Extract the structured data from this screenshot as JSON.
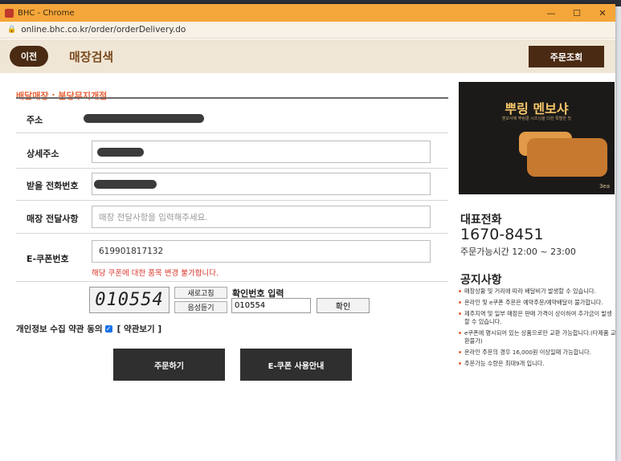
{
  "browser": {
    "title": "BHC - Chrome",
    "url": "online.bhc.co.kr/order/orderDelivery.do",
    "window_controls": [
      "minimize",
      "maximize",
      "close"
    ]
  },
  "header": {
    "back_label": "이전",
    "title": "매장검색",
    "order_lookup_label": "주문조회"
  },
  "form": {
    "store_label": "배달매장 : 분당무지개점",
    "address_label": "주소",
    "detail_address_label": "상세주소",
    "phone_label": "받을 전화번호",
    "message_label": "매장 전달사항",
    "message_placeholder": "매장 전달사항을 입력해주세요.",
    "coupon_label": "E-쿠폰번호",
    "coupon_value": "619901817132",
    "coupon_error": "해당 쿠폰에 대한 품목 변경 불가합니다.",
    "captcha_text": "010554",
    "refresh_label": "새로고침",
    "audio_label": "음성듣기",
    "verify_label": "확인번호 입력",
    "verify_value": "010554",
    "confirm_label": "확인",
    "privacy_label": "개인정보 수집 약관 동의",
    "privacy_checked": true,
    "terms_link": "[ 약관보기 ]",
    "order_button": "주문하기",
    "coupon_guide_button": "E-쿠폰 사용안내"
  },
  "sidebar": {
    "promo_title": "뿌링 멘보샤",
    "promo_subtitle": "멘보샤에 뿌링클 시즈닝을 더한 특별한 맛",
    "promo_tag": "3ea",
    "phone_heading": "대표전화",
    "phone_number": "1670-8451",
    "hours": "주문가능시간 12:00 ~ 23:00",
    "notice_heading": "공지사항",
    "notices": [
      "매장상황 및 거리에 따라 배달비가 발생할 수 있습니다.",
      "온라인 및 e쿠폰 주문은 예약주문/예약배달이 불가합니다.",
      "제주지역 및 일부 매장은 판매 가격이 상이하여 추가금이 발생할 수 있습니다.",
      "e쿠폰에 명시되어 있는 상품으로만 교환 가능합니다.(타제품 교환불가)",
      "온라인 주문의 경우 16,000원 이상일때 가능합니다.",
      "주문가능 수량은 최대9개 입니다."
    ]
  }
}
